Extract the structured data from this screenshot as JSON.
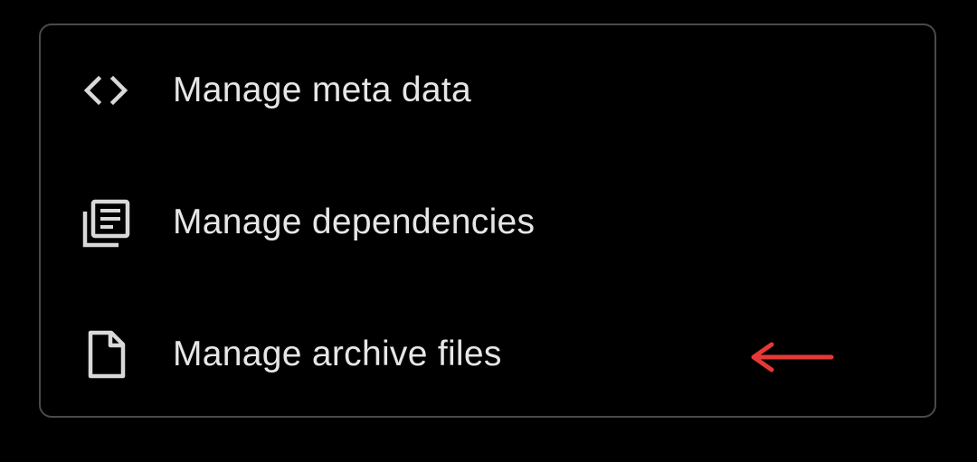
{
  "menu": {
    "items": [
      {
        "label": "Manage meta data",
        "icon": "code-brackets-icon"
      },
      {
        "label": "Manage dependencies",
        "icon": "library-books-icon"
      },
      {
        "label": "Manage archive files",
        "icon": "file-icon"
      }
    ]
  },
  "colors": {
    "background": "#000000",
    "border": "#4a4a4a",
    "text": "#e6e6e6",
    "icon": "#d9d9d9",
    "annotation_arrow": "#e53935"
  }
}
